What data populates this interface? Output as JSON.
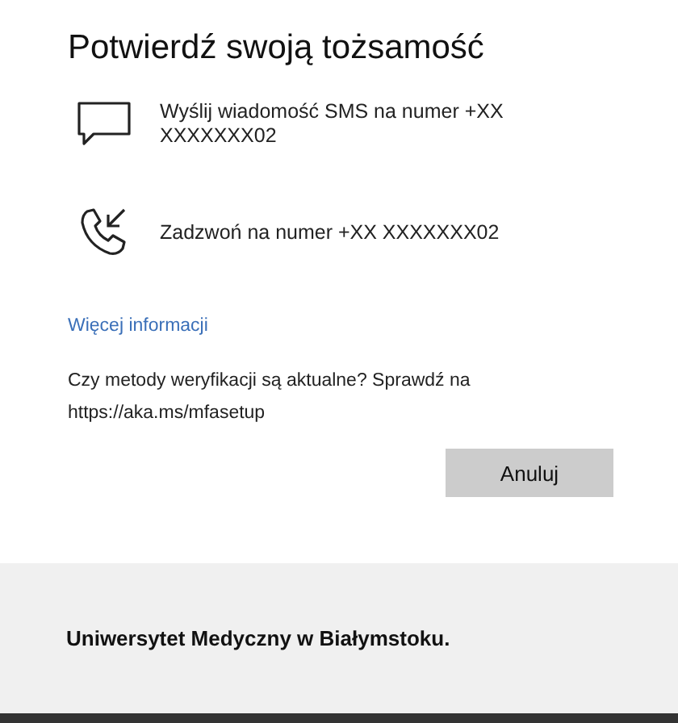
{
  "title": "Potwierdź swoją tożsamość",
  "options": [
    {
      "kind": "sms",
      "label": "Wyślij wiadomość SMS na numer +XX XXXXXXX02"
    },
    {
      "kind": "call",
      "label": "Zadzwoń na numer +XX XXXXXXX02"
    }
  ],
  "more_link": "Więcej informacji",
  "note": "Czy metody weryfikacji są aktualne? Sprawdź na https://aka.ms/mfasetup",
  "cancel_button": "Anuluj",
  "footer": "Uniwersytet Medyczny w Białymstoku."
}
